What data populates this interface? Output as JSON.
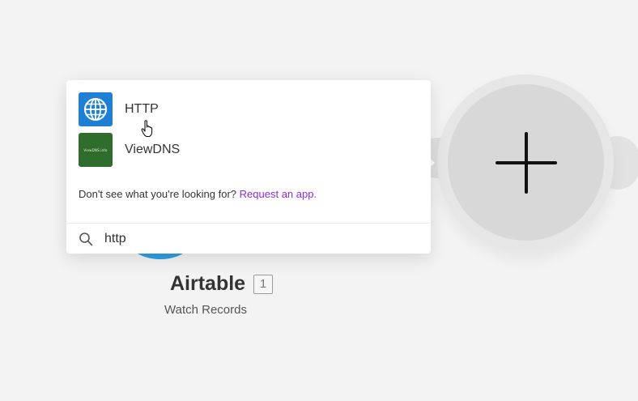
{
  "results": [
    {
      "label": "HTTP",
      "icon": "globe-icon"
    },
    {
      "label": "ViewDNS",
      "icon": "viewdns-logo",
      "logo_text": "ViewDNS.info"
    }
  ],
  "hint": {
    "text": "Don't see what you're looking for?",
    "link": "Request an app."
  },
  "search": {
    "value": "http",
    "icon": "search-icon"
  },
  "module": {
    "name": "Airtable",
    "badge": "1",
    "action": "Watch Records"
  },
  "add_button": {
    "icon": "plus-icon"
  },
  "colors": {
    "http_icon_bg": "#1e7fd6",
    "viewdns_icon_bg": "#2f6d2c",
    "link": "#8a2be2",
    "airtable_node": "#2d9fe0"
  }
}
